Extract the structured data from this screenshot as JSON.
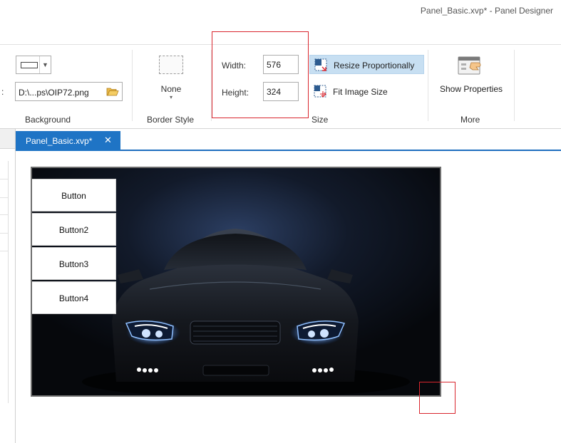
{
  "window": {
    "title": "Panel_Basic.xvp* - Panel Designer"
  },
  "ribbon": {
    "background": {
      "colon": ":",
      "image_path": "D:\\...ps\\OIP72.png",
      "group_label": "Background"
    },
    "border_style": {
      "value": "None",
      "group_label": "Border Style"
    },
    "size": {
      "width_label": "Width:",
      "width_value": "576",
      "height_label": "Height:",
      "height_value": "324",
      "resize_proportionally_label": "Resize Proportionally",
      "fit_image_size_label": "Fit Image Size",
      "group_label": "Size"
    },
    "more": {
      "show_properties_label": "Show Properties",
      "group_label": "More"
    }
  },
  "document": {
    "tab_label": "Panel_Basic.xvp*",
    "tab_close": "✕"
  },
  "panel": {
    "buttons": [
      "Button",
      "Button2",
      "Button3",
      "Button4"
    ]
  },
  "colors": {
    "accent": "#1f74c5",
    "highlight": "#c7dff2",
    "annotation": "#d9262e"
  },
  "icons": [
    "dropdown-arrow-icon",
    "folder-open-icon",
    "resize-proportionally-icon",
    "fit-image-size-icon",
    "show-properties-icon",
    "close-icon"
  ]
}
